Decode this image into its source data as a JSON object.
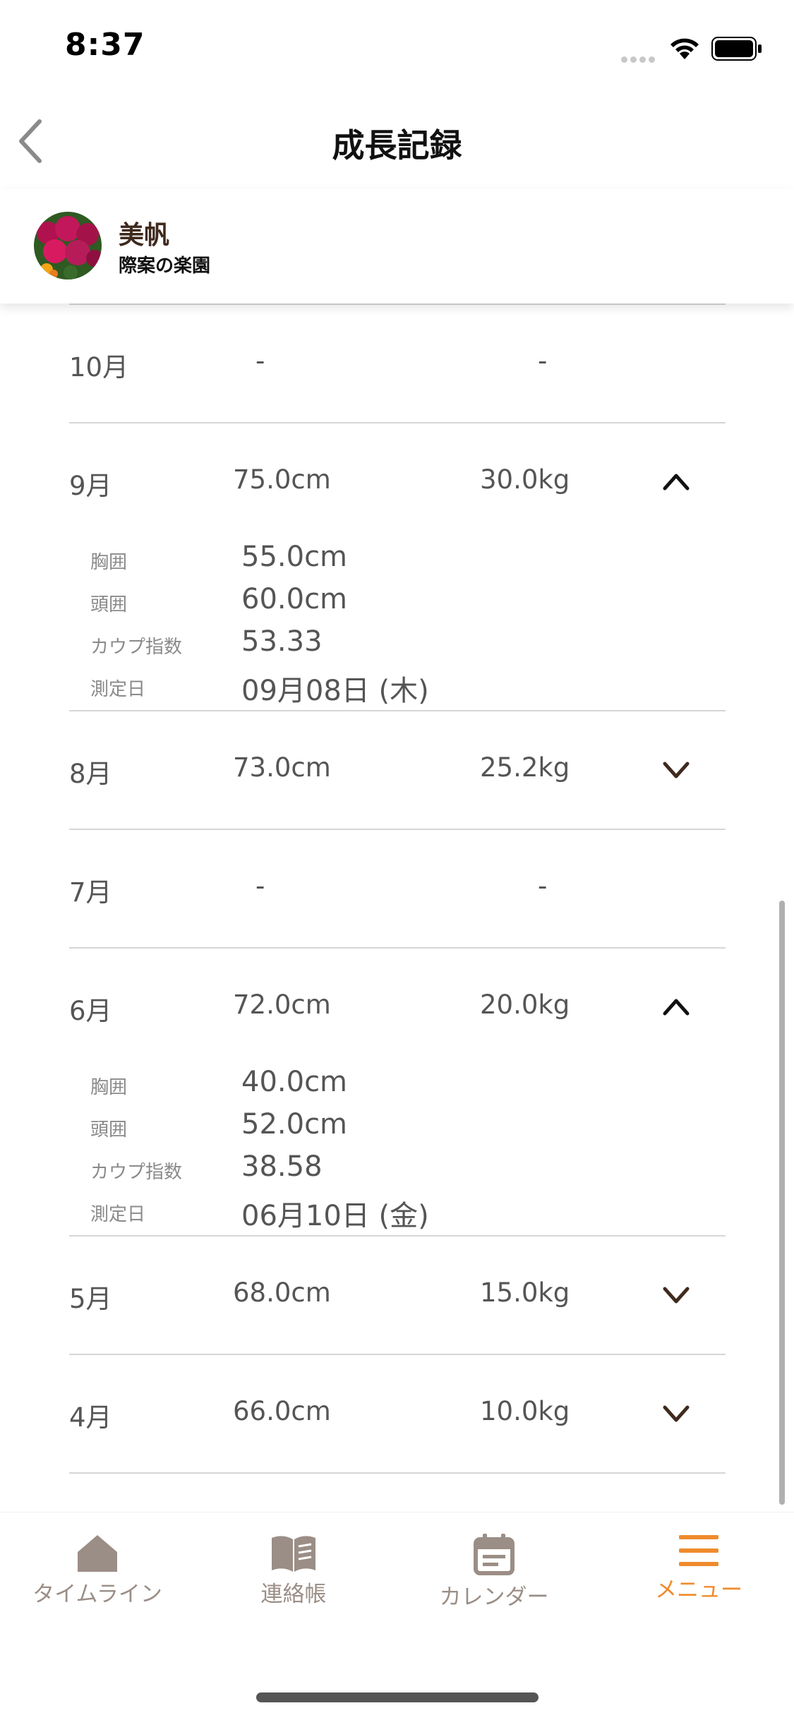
{
  "status_bar": {
    "time": "8:37"
  },
  "nav": {
    "title": "成長記録"
  },
  "profile": {
    "name": "美帆",
    "school": "際案の楽園"
  },
  "records": [
    {
      "month": "10月",
      "height": "-",
      "weight": "-",
      "expanded": false,
      "empty": true
    },
    {
      "month": "9月",
      "height": "75.0cm",
      "weight": "30.0kg",
      "expanded": true,
      "details": [
        {
          "label": "胸囲",
          "value": "55.0cm"
        },
        {
          "label": "頭囲",
          "value": "60.0cm"
        },
        {
          "label": "カウプ指数",
          "value": "53.33"
        },
        {
          "label": "測定日",
          "value": "09月08日 (木)"
        }
      ]
    },
    {
      "month": "8月",
      "height": "73.0cm",
      "weight": "25.2kg",
      "expanded": false
    },
    {
      "month": "7月",
      "height": "-",
      "weight": "-",
      "expanded": false,
      "empty": true
    },
    {
      "month": "6月",
      "height": "72.0cm",
      "weight": "20.0kg",
      "expanded": true,
      "details": [
        {
          "label": "胸囲",
          "value": "40.0cm"
        },
        {
          "label": "頭囲",
          "value": "52.0cm"
        },
        {
          "label": "カウプ指数",
          "value": "38.58"
        },
        {
          "label": "測定日",
          "value": "06月10日 (金)"
        }
      ]
    },
    {
      "month": "5月",
      "height": "68.0cm",
      "weight": "15.0kg",
      "expanded": false
    },
    {
      "month": "4月",
      "height": "66.0cm",
      "weight": "10.0kg",
      "expanded": false
    }
  ],
  "tabs": [
    {
      "label": "タイムライン",
      "icon": "home-icon",
      "active": false
    },
    {
      "label": "連絡帳",
      "icon": "book-icon",
      "active": false
    },
    {
      "label": "カレンダー",
      "icon": "calendar-icon",
      "active": false
    },
    {
      "label": "メニュー",
      "icon": "menu-icon",
      "active": true
    }
  ],
  "colors": {
    "accent": "#ef8b2c",
    "tab_inactive": "#9b8e86",
    "brand_dark": "#3f2a1e"
  }
}
